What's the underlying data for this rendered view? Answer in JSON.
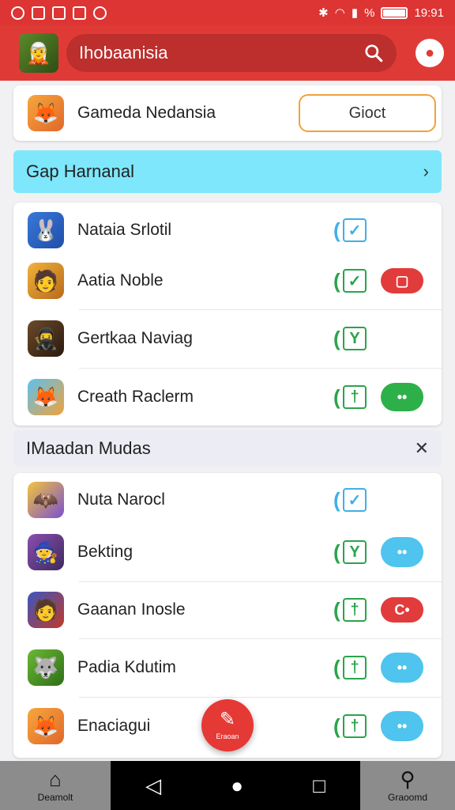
{
  "status_bar": {
    "time": "19:91",
    "signal_text": "%"
  },
  "app_bar": {
    "title": "Ihobaanisia"
  },
  "top_card": {
    "label": "Gameda Nedansia",
    "button_label": "Gioct"
  },
  "section1": {
    "title": "Gap Harnanal",
    "action_glyph": "›"
  },
  "list1": [
    {
      "name": "Nataia Srlotil",
      "check_style": "blue",
      "check_glyph": "✓",
      "pill": null
    },
    {
      "name": "Aatia Noble",
      "check_style": "green",
      "check_glyph": "✓",
      "pill": {
        "style": "red",
        "glyph": "▢"
      }
    },
    {
      "name": "Gertkaa Naviag",
      "check_style": "green",
      "check_glyph": "Y",
      "pill": null
    },
    {
      "name": "Creath Raclerm",
      "check_style": "green",
      "check_glyph": "†",
      "pill": {
        "style": "green",
        "glyph": "••"
      }
    }
  ],
  "section2": {
    "title": "IMaadan Mudas",
    "action_glyph": "✕"
  },
  "list2": [
    {
      "name": "Nuta Narocl",
      "check_style": "blue",
      "check_glyph": "✓",
      "pill": null
    },
    {
      "name": "Bekting",
      "check_style": "green",
      "check_glyph": "Y",
      "pill": {
        "style": "blue",
        "glyph": "••"
      }
    },
    {
      "name": "Gaanan Inosle",
      "check_style": "green",
      "check_glyph": "†",
      "pill": {
        "style": "red",
        "glyph": "C•"
      }
    },
    {
      "name": "Padia Kdutim",
      "check_style": "green",
      "check_glyph": "†",
      "pill": {
        "style": "blue",
        "glyph": "••"
      }
    },
    {
      "name": "Enaciagui",
      "check_style": "green",
      "check_glyph": "†",
      "pill": {
        "style": "blue",
        "glyph": "••"
      }
    }
  ],
  "fab": {
    "label": "Eraoan"
  },
  "bottom_nav": {
    "left_label": "Deamolt",
    "right_label": "Graoomd"
  },
  "colors": {
    "accent": "#e03a37",
    "section1_bg": "#7ee7fb",
    "check_green": "#2aa44a",
    "check_blue": "#3fb0e6"
  },
  "icons": {
    "app_avatar": "game-character-icon",
    "list1": [
      "bunny-icon",
      "warrior-icon",
      "ninja-icon",
      "fox-icon"
    ],
    "list2": [
      "bat-icon",
      "hero-icon",
      "knight-icon",
      "wolf-icon",
      "fox-icon"
    ]
  }
}
